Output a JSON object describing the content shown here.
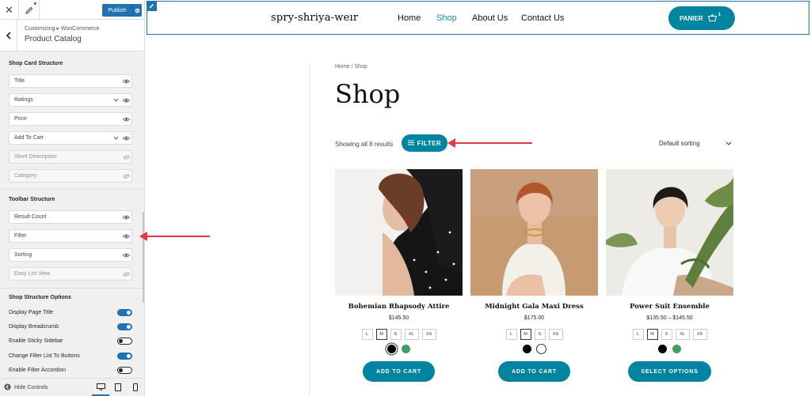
{
  "sidebar": {
    "publish_label": "Publish",
    "breadcrumb": "Customizing ▸ WooCommerce",
    "panel_title": "Product Catalog",
    "shop_card": {
      "title": "Shop Card Structure",
      "items": [
        {
          "label": "Title",
          "icon": "eye-icon",
          "disabled": false
        },
        {
          "label": "Ratings",
          "icon": "eye-icon",
          "disabled": false,
          "expandable": true
        },
        {
          "label": "Price",
          "icon": "eye-icon",
          "disabled": false
        },
        {
          "label": "Add To Cart",
          "icon": "eye-icon",
          "disabled": false,
          "expandable": true
        },
        {
          "label": "Short Description",
          "icon": "eye-slash-icon",
          "disabled": true
        },
        {
          "label": "Category",
          "icon": "eye-slash-icon",
          "disabled": true
        }
      ]
    },
    "toolbar": {
      "title": "Toolbar Structure",
      "items": [
        {
          "label": "Result Count",
          "icon": "eye-icon",
          "disabled": false
        },
        {
          "label": "Filter",
          "icon": "eye-icon",
          "disabled": false
        },
        {
          "label": "Sorting",
          "icon": "eye-icon",
          "disabled": false
        },
        {
          "label": "Easy List View",
          "icon": "eye-slash-icon",
          "disabled": true
        }
      ]
    },
    "options": {
      "title": "Shop Structure Options",
      "items": [
        {
          "label": "Display Page Title",
          "on": true
        },
        {
          "label": "Display Breadcrumb",
          "on": true
        },
        {
          "label": "Enable Sticky Sidebar",
          "on": false
        },
        {
          "label": "Change Filter List To Buttons",
          "on": true
        },
        {
          "label": "Enable Filter Accordion",
          "on": false
        }
      ]
    },
    "hide_controls": "Hide Controls",
    "accent": "#2271b1"
  },
  "site": {
    "title": "spry-shriya-weır",
    "nav": [
      "Home",
      "Shop",
      "About Us",
      "Contact Us"
    ],
    "active_nav": "Shop",
    "cart_label": "PANIER",
    "cart_count": "1",
    "accent": "#00849f"
  },
  "shop": {
    "breadcrumb": "Home / Shop",
    "title": "Shop",
    "result_count": "Showing all 8 results",
    "filter_label": "FILTER",
    "sorting": "Default sorting",
    "products": [
      {
        "name": "Bohemian Rhapsody Attire",
        "price": "$145.50",
        "sizes": [
          "L",
          "M",
          "S",
          "XL",
          "XS"
        ],
        "selected_size": "M",
        "colors": [
          "#000000",
          "#3d9e6a"
        ],
        "button": "ADD TO CART"
      },
      {
        "name": "Midnight Gala Maxi Dress",
        "price": "$175.00",
        "sizes": [
          "L",
          "M",
          "S",
          "XS"
        ],
        "selected_size": "M",
        "colors": [
          "#000000",
          "#ffffff"
        ],
        "button": "ADD TO CART"
      },
      {
        "name": "Power Suit Ensemble",
        "price": "$135.50 – $145.50",
        "sizes": [
          "L",
          "M",
          "S",
          "XL",
          "XS"
        ],
        "selected_size": "M",
        "colors": [
          "#000000",
          "#3d9e6a"
        ],
        "button": "SELECT OPTIONS"
      }
    ]
  }
}
